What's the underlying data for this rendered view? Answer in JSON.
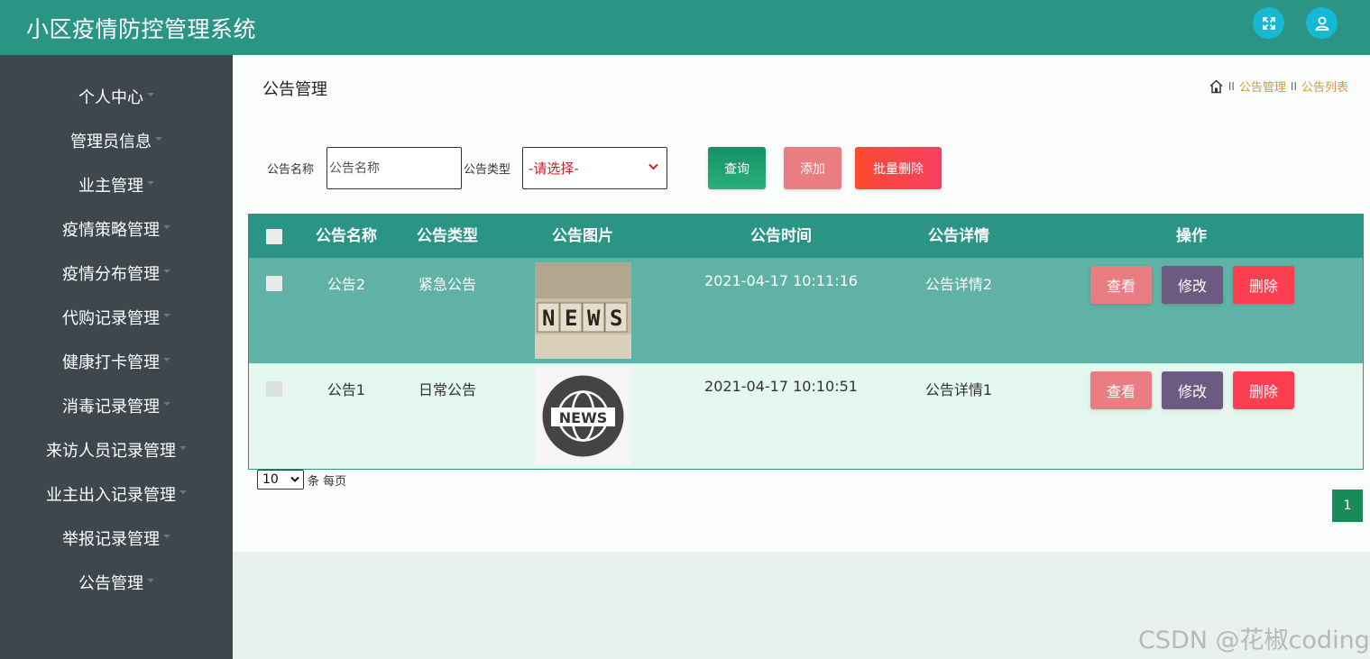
{
  "header": {
    "title": "小区疫情防控管理系统",
    "icons": [
      "expand-icon",
      "user-icon"
    ]
  },
  "sidebar": {
    "items": [
      {
        "label": "个人中心"
      },
      {
        "label": "管理员信息"
      },
      {
        "label": "业主管理"
      },
      {
        "label": "疫情策略管理"
      },
      {
        "label": "疫情分布管理"
      },
      {
        "label": "代购记录管理"
      },
      {
        "label": "健康打卡管理"
      },
      {
        "label": "消毒记录管理"
      },
      {
        "label": "来访人员记录管理"
      },
      {
        "label": "业主出入记录管理"
      },
      {
        "label": "举报记录管理"
      },
      {
        "label": "公告管理"
      }
    ]
  },
  "page": {
    "title": "公告管理",
    "breadcrumb": {
      "sep1": "II",
      "item1": "公告管理",
      "sep2": "II",
      "item2": "公告列表"
    }
  },
  "search": {
    "name_label": "公告名称",
    "name_placeholder": "公告名称",
    "type_label": "公告类型",
    "type_value": "-请选择-",
    "query_label": "查询",
    "add_label": "添加",
    "batch_delete_label": "批量删除"
  },
  "table": {
    "headers": {
      "name": "公告名称",
      "type": "公告类型",
      "image": "公告图片",
      "time": "公告时间",
      "detail": "公告详情",
      "actions": "操作"
    },
    "rows": [
      {
        "name": "公告2",
        "type": "紧急公告",
        "image": "NEWS",
        "time": "2021-04-17 10:11:16",
        "detail": "公告详情2"
      },
      {
        "name": "公告1",
        "type": "日常公告",
        "image": "NEWS",
        "time": "2021-04-17 10:10:51",
        "detail": "公告详情1"
      }
    ],
    "actions": {
      "view": "查看",
      "edit": "修改",
      "delete": "删除"
    }
  },
  "pagination": {
    "page_size": "10",
    "page_size_label": "条 每页",
    "current_page": "1"
  },
  "watermark": "CSDN @花椒coding",
  "colors": {
    "header": "#2a9485",
    "sidebar": "#3d474d",
    "accent_link": "#d49a35",
    "row_active": "#5fb2a5",
    "row_light": "#e4f6ee"
  }
}
